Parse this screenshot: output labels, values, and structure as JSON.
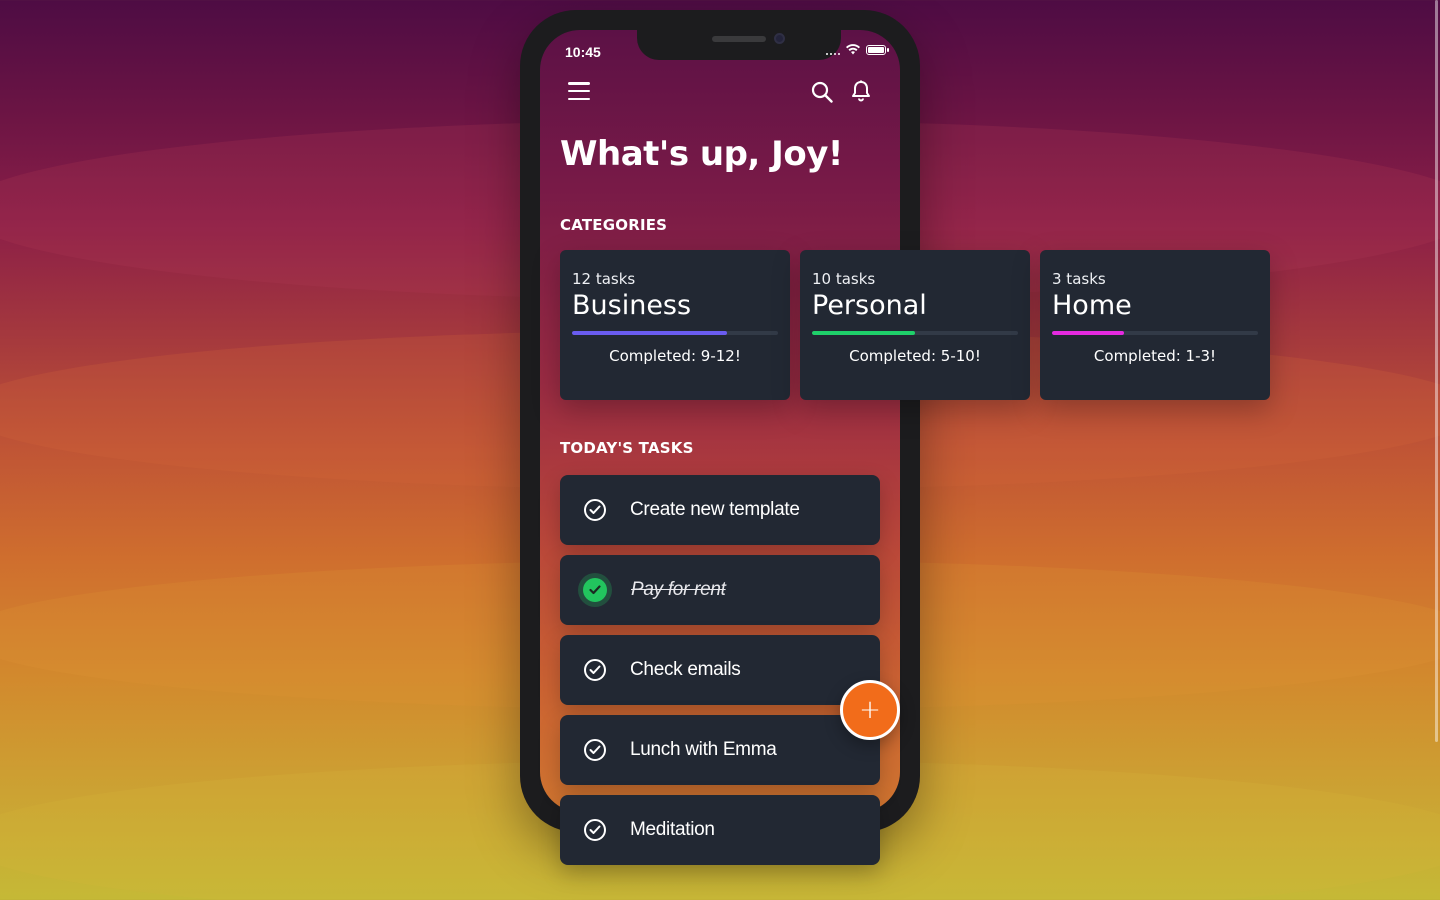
{
  "status_bar": {
    "time": "10:45"
  },
  "header": {
    "greeting": "What's up, Joy!"
  },
  "sections": {
    "categories": "CATEGORIES",
    "todays_tasks": "TODAY'S TASKS"
  },
  "categories": [
    {
      "count": "12 tasks",
      "name": "Business",
      "completed": "Completed: 9-12!",
      "progress": 0.75,
      "color": "#6a5cf0"
    },
    {
      "count": "10 tasks",
      "name": "Personal",
      "completed": "Completed: 5-10!",
      "progress": 0.5,
      "color": "#1fd06a"
    },
    {
      "count": "3 tasks",
      "name": "Home",
      "completed": "Completed: 1-3!",
      "progress": 0.35,
      "color": "#e52ae0"
    }
  ],
  "tasks": [
    {
      "label": "Create new template",
      "done": false
    },
    {
      "label": "Pay for rent",
      "done": true
    },
    {
      "label": "Check emails",
      "done": false
    },
    {
      "label": "Lunch with Emma",
      "done": false
    },
    {
      "label": "Meditation",
      "done": false
    }
  ],
  "fab": {
    "label": "+"
  },
  "icons": {
    "menu": "hamburger-menu-icon",
    "search": "search-icon",
    "notifications": "bell-icon",
    "task_check": "check-circle-icon"
  },
  "colors": {
    "card_bg": "#222833",
    "accent_fab": "#f26c1a",
    "done_green": "#22c55e"
  }
}
